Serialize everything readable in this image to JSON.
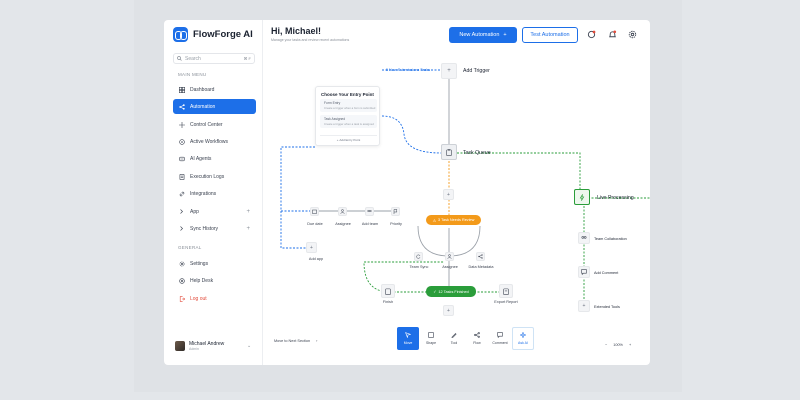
{
  "app": {
    "name": "FlowForge AI",
    "search_placeholder": "Search",
    "search_shortcut": "⌘ F",
    "main_menu_label": "MAIN MENU",
    "general_label": "GENERAL"
  },
  "sidebar": {
    "items": [
      {
        "label": "Dashboard",
        "icon": "grid-icon"
      },
      {
        "label": "Automation",
        "icon": "share-icon",
        "active": true
      },
      {
        "label": "Control Center",
        "icon": "crosshair-icon"
      },
      {
        "label": "Active Workflows",
        "icon": "workflow-icon"
      },
      {
        "label": "AI Agents",
        "icon": "agent-icon"
      },
      {
        "label": "Execution Logs",
        "icon": "log-icon"
      },
      {
        "label": "Integrations",
        "icon": "link-icon"
      },
      {
        "label": "App",
        "icon": "chevron-right-icon",
        "plus": "+"
      },
      {
        "label": "Sync History",
        "icon": "chevron-right-icon",
        "plus": "+"
      }
    ],
    "general": [
      {
        "label": "Settings",
        "icon": "gear-icon"
      },
      {
        "label": "Help Desk",
        "icon": "help-icon"
      },
      {
        "label": "Log out",
        "icon": "logout-icon"
      }
    ],
    "user": {
      "name": "Michael Andrew",
      "role": "Admin"
    }
  },
  "header": {
    "greeting": "Hi, Michael!",
    "subtitle": "Manage your tasks and review recent automations",
    "new_automation": "New Automation",
    "test_automation": "Test Automation"
  },
  "canvas": {
    "new_submissions": "5 New Submissions Tasks",
    "add_trigger": "Add Trigger",
    "task_queue": "Task Queue",
    "live_processing": "Live Processing",
    "entry_card": {
      "title": "Choose Your Entry Point",
      "options": [
        {
          "title": "Form Entry",
          "desc": "Create a trigger when a form is submitted"
        },
        {
          "title": "Task Assigned",
          "desc": "Create a trigger when a task is assigned"
        }
      ],
      "footer": "Add Entry Point"
    },
    "row_nodes": [
      "Due date",
      "Assignee",
      "Add team",
      "Priority"
    ],
    "add_app": "Add app",
    "pending_pill": "3 Task Needs Review",
    "mid_nodes": [
      "Team Sync",
      "Assignee",
      "Data Metadata"
    ],
    "finish": "Finish",
    "finished_pill": "12 Tasks Finished",
    "export_report": "Export Report",
    "right_nodes": [
      "Team Collaboration",
      "Add Comment",
      "Extended Tools"
    ]
  },
  "bottom": {
    "move_next": "Move to Next Section",
    "tools": [
      {
        "label": "Move",
        "icon": "cursor-icon",
        "active": true
      },
      {
        "label": "Shape",
        "icon": "shape-icon"
      },
      {
        "label": "Tool",
        "icon": "pen-icon"
      },
      {
        "label": "Flow",
        "icon": "flow-icon"
      },
      {
        "label": "Comment",
        "icon": "comment-icon"
      },
      {
        "label": "Ask AI",
        "icon": "ai-icon",
        "ai": true
      }
    ],
    "zoom_minus": "−",
    "zoom_value": "100%",
    "zoom_plus": "+"
  },
  "colors": {
    "primary": "#1d6fe8",
    "orange": "#f39a1a",
    "green": "#2a9d3a",
    "logout": "#e24b3b"
  }
}
